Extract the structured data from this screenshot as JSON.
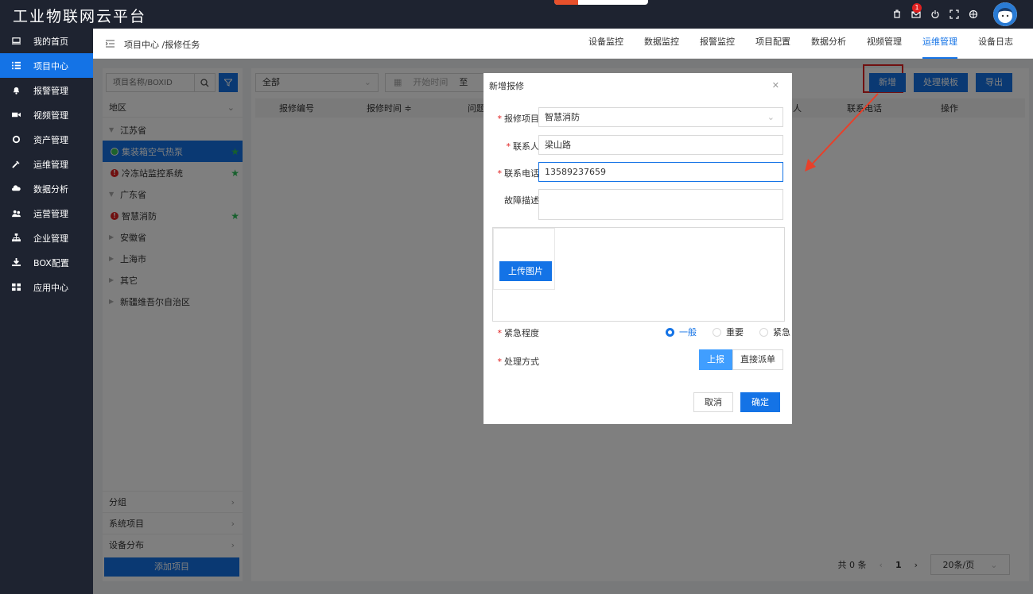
{
  "app": {
    "title": "工业物联网云平台",
    "notification_count": "1"
  },
  "sidebar": {
    "items": [
      {
        "label": "我的首页",
        "icon": "monitor-icon"
      },
      {
        "label": "项目中心",
        "icon": "list-icon"
      },
      {
        "label": "报警管理",
        "icon": "bell-icon"
      },
      {
        "label": "视频管理",
        "icon": "video-icon"
      },
      {
        "label": "资产管理",
        "icon": "recycle-icon"
      },
      {
        "label": "运维管理",
        "icon": "wrench-icon"
      },
      {
        "label": "数据分析",
        "icon": "cloud-icon"
      },
      {
        "label": "运营管理",
        "icon": "people-icon"
      },
      {
        "label": "企业管理",
        "icon": "org-icon"
      },
      {
        "label": "BOX配置",
        "icon": "download-icon"
      },
      {
        "label": "应用中心",
        "icon": "grid-icon"
      }
    ],
    "active_index": 1
  },
  "header": {
    "breadcrumb": "项目中心 /报修任务",
    "tabs": [
      "设备监控",
      "数据监控",
      "报警监控",
      "项目配置",
      "数据分析",
      "视频管理",
      "运维管理",
      "设备日志"
    ],
    "active_tab": 6
  },
  "tree_panel": {
    "search_placeholder": "项目名称/BOXID",
    "region_label": "地区",
    "nodes": [
      {
        "label": "江苏省",
        "type": "province",
        "expanded": true
      },
      {
        "label": "集装箱空气热泵",
        "type": "project",
        "status": "online",
        "starred": true,
        "selected": true
      },
      {
        "label": "冷冻站监控系统",
        "type": "project",
        "status": "alarm",
        "starred": true
      },
      {
        "label": "广东省",
        "type": "province",
        "expanded": true
      },
      {
        "label": "智慧消防",
        "type": "project",
        "status": "alarm",
        "starred": true
      },
      {
        "label": "安徽省",
        "type": "province"
      },
      {
        "label": "上海市",
        "type": "province"
      },
      {
        "label": "其它",
        "type": "province"
      },
      {
        "label": "新疆维吾尔自治区",
        "type": "province"
      }
    ],
    "bottom_sections": [
      "分组",
      "系统项目",
      "设备分布"
    ],
    "add_project_label": "添加项目"
  },
  "main": {
    "status_filter": "全部",
    "start_date_placeholder": "开始时间",
    "date_separator": "至",
    "buttons": {
      "add": "新增",
      "template": "处理模板",
      "export": "导出"
    },
    "columns": [
      "报修编号",
      "报修时间 ≑",
      "问题",
      "人",
      "联系电话",
      "操作"
    ],
    "pagination": {
      "total": "共 0 条",
      "current_page": "1",
      "page_size": "20条/页"
    }
  },
  "modal": {
    "title": "新增报修",
    "fields": {
      "project": {
        "label": "报修项目",
        "value": "智慧消防"
      },
      "contact": {
        "label": "联系人",
        "value": "梁山路"
      },
      "phone": {
        "label": "联系电话",
        "value": "13589237659"
      },
      "description": {
        "label": "故障描述",
        "value": ""
      }
    },
    "upload_label": "上传图片",
    "urgency": {
      "label": "紧急程度",
      "options": [
        "一般",
        "重要",
        "紧急"
      ],
      "selected": "一般"
    },
    "method": {
      "label": "处理方式",
      "options": [
        "上报",
        "直接派单"
      ],
      "selected": "上报"
    },
    "cancel_label": "取消",
    "confirm_label": "确定"
  },
  "colors": {
    "primary": "#1473e6",
    "nav_bg": "#1e2330",
    "alarm": "#e02020",
    "online": "#3bc45a",
    "star": "#2fc15a"
  }
}
